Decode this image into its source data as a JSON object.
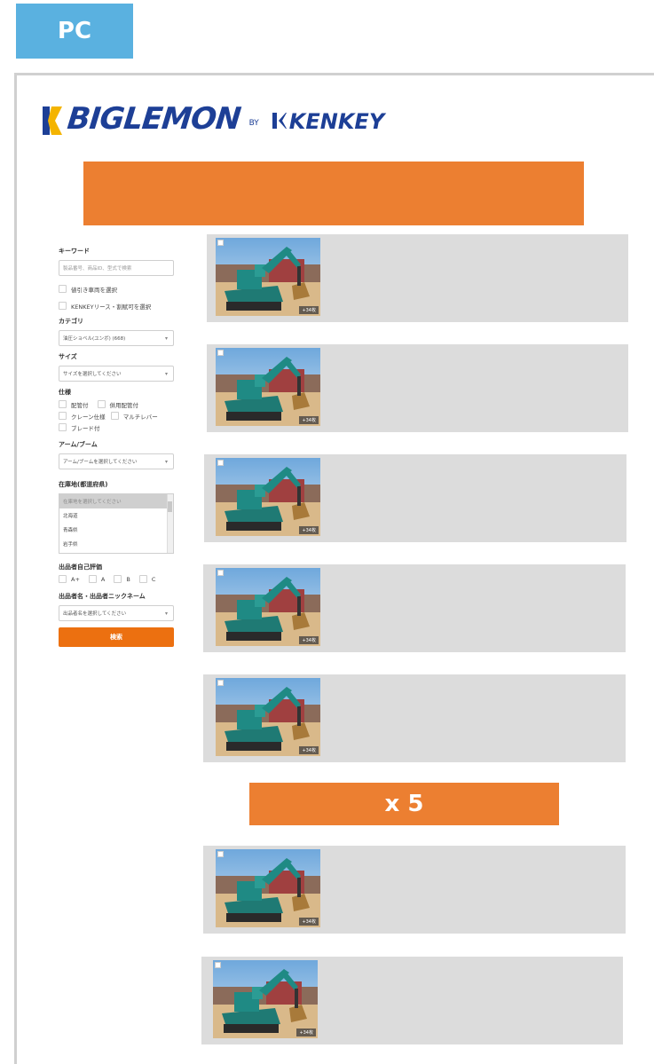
{
  "device_tab": "PC",
  "logo": {
    "main": "BIGLEMON",
    "by": "BY",
    "partner": "KENKEY"
  },
  "sidebar": {
    "keyword_label": "キーワード",
    "keyword_placeholder": "製品番号、商品ID、型式で検索",
    "checkbox_discount": "値引き車両を選択",
    "checkbox_kenkey": "KENKEYリース・割賦可を選択",
    "category_label": "カテゴリ",
    "category_value": "油圧ショベル(ユンボ) (668)",
    "size_label": "サイズ",
    "size_value": "サイズを選択してください",
    "spec_label": "仕様",
    "spec_options": [
      "配管付",
      "併用配管付",
      "クレーン仕様",
      "マルチレバー",
      "ブレード付"
    ],
    "arm_label": "アーム/ブーム",
    "arm_value": "アーム/ブームを選択してください",
    "location_label": "在庫地(都道府県)",
    "location_options": [
      "在庫地を選択してください",
      "北海道",
      "青森県",
      "岩手県"
    ],
    "rating_label": "出品者自己評価",
    "rating_options": [
      "A+",
      "A",
      "B",
      "C"
    ],
    "seller_label": "出品者名・出品者ニックネーム",
    "seller_value": "出品者名を選択してください",
    "search_button": "検索"
  },
  "photo_count": "+34枚",
  "repeat_label": "x 5",
  "colors": {
    "accent_orange": "#ec7f31",
    "tab_blue": "#5ab1e0",
    "brand_navy": "#1d3f96",
    "card_gray": "#dcdcdc"
  }
}
